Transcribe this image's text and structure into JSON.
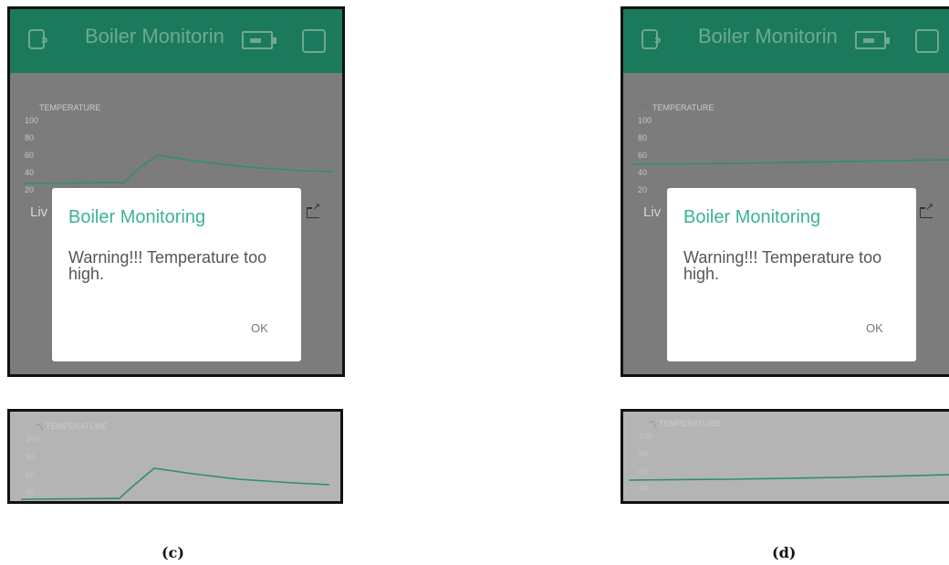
{
  "panels": [
    {
      "id": "c",
      "header_title": "Boiler Monitorin",
      "graph_label": "TEMPERATURE",
      "y_ticks": [
        "100",
        "80",
        "60",
        "40",
        "20"
      ],
      "live_label": "Liv",
      "dialog": {
        "title": "Boiler Monitoring",
        "message": "Warning!!! Temperature too high.",
        "ok": "OK"
      },
      "strip_label": "TEMPERATURE",
      "strip_ticks": [
        "100",
        "80",
        "60",
        "40"
      ],
      "caption": "(c)"
    },
    {
      "id": "d",
      "header_title": "Boiler Monitorin",
      "graph_label": "TEMPERATURE",
      "y_ticks": [
        "100",
        "80",
        "60",
        "40",
        "20"
      ],
      "live_label": "Liv",
      "dialog": {
        "title": "Boiler Monitoring",
        "message": "Warning!!! Temperature too high.",
        "ok": "OK"
      },
      "strip_label": "TEMPERATURE",
      "strip_ticks": [
        "100",
        "80",
        "60",
        "40"
      ],
      "caption": "(d)"
    }
  ],
  "icons": {
    "app": "tag-icon",
    "device": "device-icon",
    "settings": "square-icon",
    "chart": "line-chart-icon",
    "share": "share-icon"
  },
  "colors": {
    "header": "#1b7a5c",
    "accent": "#3bb393",
    "line": "#2e8f6b",
    "overlay": "#7c7c7c"
  }
}
